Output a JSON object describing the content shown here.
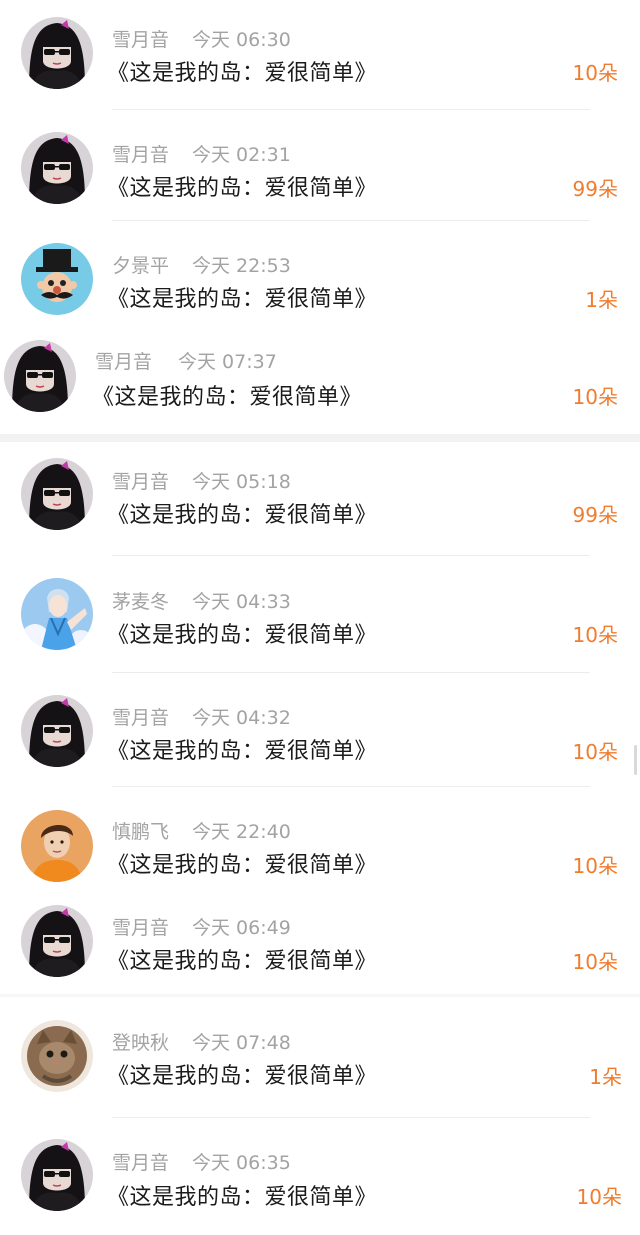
{
  "common_title": "《这是我的岛：爱很简单》",
  "entries": [
    {
      "name": "雪月音",
      "time": "今天 06:30",
      "title": "《这是我的岛：爱很简单》",
      "amount": "10朵",
      "avatar": "black-hair-sunglasses-girl"
    },
    {
      "name": "雪月音",
      "time": "今天 02:31",
      "title": "《这是我的岛：爱很简单》",
      "amount": "99朵",
      "avatar": "black-hair-sunglasses-girl"
    },
    {
      "name": "夕景平",
      "time": "今天 22:53",
      "title": "《这是我的岛：爱很简单》",
      "amount": "1朵",
      "avatar": "top-hat-mustache-cartoon"
    },
    {
      "name": "雪月音",
      "time": "今天 07:37",
      "title": "《这是我的岛：爱很简单》",
      "amount": "10朵",
      "avatar": "black-hair-sunglasses-girl"
    },
    {
      "name": "雪月音",
      "time": "今天 05:18",
      "title": "《这是我的岛：爱很简单》",
      "amount": "99朵",
      "avatar": "black-hair-sunglasses-girl"
    },
    {
      "name": "茅麦冬",
      "time": "今天 04:33",
      "title": "《这是我的岛：爱很简单》",
      "amount": "10朵",
      "avatar": "anime-boy-blue-sky"
    },
    {
      "name": "雪月音",
      "time": "今天 04:32",
      "title": "《这是我的岛：爱很简单》",
      "amount": "10朵",
      "avatar": "black-hair-sunglasses-girl"
    },
    {
      "name": "慎鹏飞",
      "time": "今天 22:40",
      "title": "《这是我的岛：爱很简单》",
      "amount": "10朵",
      "avatar": "young-man-orange-shirt"
    },
    {
      "name": "雪月音",
      "time": "今天 06:49",
      "title": "《这是我的岛：爱很简单》",
      "amount": "10朵",
      "avatar": "black-hair-sunglasses-girl"
    },
    {
      "name": "登映秋",
      "time": "今天 07:48",
      "title": "《这是我的岛：爱很简单》",
      "amount": "1朵",
      "avatar": "kitten-photo"
    },
    {
      "name": "雪月音",
      "time": "今天 06:35",
      "title": "《这是我的岛：爱很简单》",
      "amount": "10朵",
      "avatar": "black-hair-sunglasses-girl"
    }
  ],
  "colors": {
    "amount_orange": "#f07c2e",
    "meta_gray": "#a3a3a3",
    "title_black": "#1b1b1b",
    "separator_gray": "#f2f2f2"
  }
}
